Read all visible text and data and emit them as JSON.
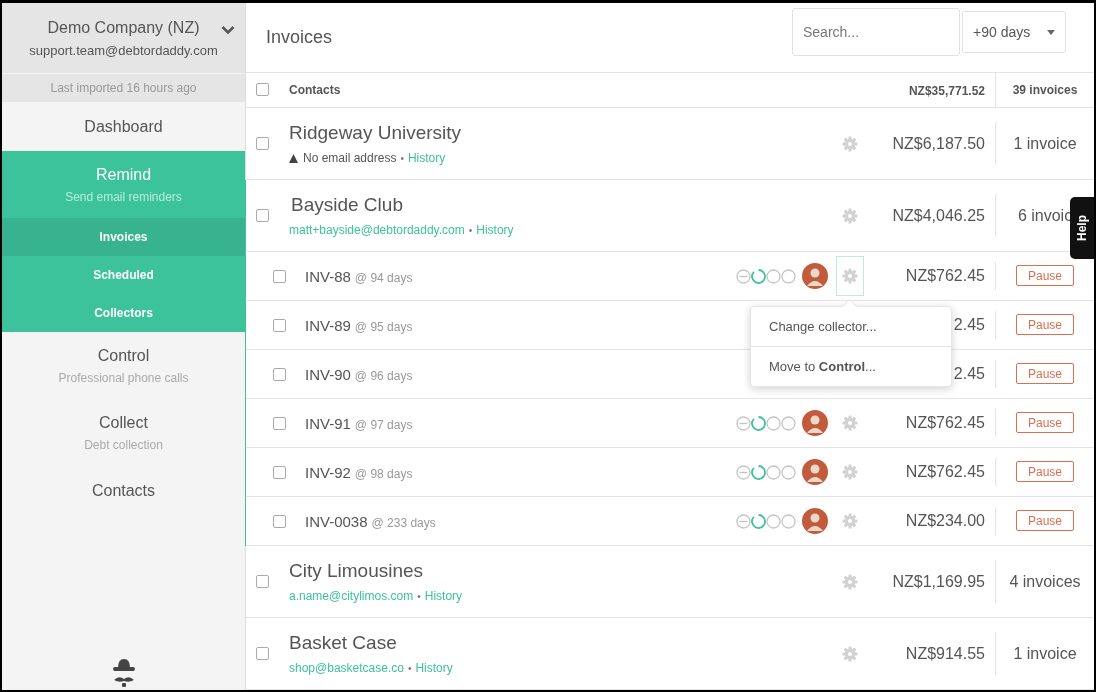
{
  "account": {
    "name": "Demo Company (NZ)",
    "email": "support.team@debtordaddy.com"
  },
  "last_imported": "Last imported 16 hours ago",
  "nav": [
    {
      "label": "Dashboard",
      "selected": false
    },
    {
      "label": "Remind",
      "subtitle": "Send email reminders",
      "selected": true,
      "children": [
        {
          "label": "Invoices",
          "selected": true
        },
        {
          "label": "Scheduled",
          "selected": false
        },
        {
          "label": "Collectors",
          "selected": false
        }
      ]
    },
    {
      "label": "Control",
      "subtitle": "Professional phone calls",
      "selected": false
    },
    {
      "label": "Collect",
      "subtitle": "Debt collection",
      "selected": false
    },
    {
      "label": "Contacts",
      "selected": false
    }
  ],
  "page_title": "Invoices",
  "search": {
    "placeholder": "Search..."
  },
  "filter": {
    "label": "+90 days"
  },
  "table_header": {
    "checked": false,
    "contacts": "Contacts",
    "total": "NZ$35,771.52",
    "count": "39 invoices"
  },
  "contacts": [
    {
      "name": "Ridgeway University",
      "checked": false,
      "info": {
        "kind": "warning",
        "text": "No email address"
      },
      "separator": "•",
      "history": "History",
      "amount": "NZ$6,187.50",
      "count": "1 invoice",
      "expanded": false
    },
    {
      "name": "Bayside Club",
      "checked": false,
      "info": {
        "kind": "email",
        "text": "matt+bayside@debtordaddy.com"
      },
      "separator": "•",
      "history": "History",
      "amount": "NZ$4,046.25",
      "count": "6 invoic",
      "expanded": true,
      "invoices": [
        {
          "number": "INV-88",
          "age": "@ 94 days",
          "checked": false,
          "steps": [
            {
              "kind": "skipped"
            },
            {
              "kind": "current"
            },
            {
              "kind": "pending"
            },
            {
              "kind": "pending"
            }
          ],
          "avatar": true,
          "gear": true,
          "menu_open": true,
          "amount": "NZ$762.45",
          "action": "Pause"
        },
        {
          "number": "INV-89",
          "age": "@ 95 days",
          "checked": false,
          "amount": "2.45",
          "action": "Pause"
        },
        {
          "number": "INV-90",
          "age": "@ 96 days",
          "checked": false,
          "amount": "2.45",
          "action": "Pause"
        },
        {
          "number": "INV-91",
          "age": "@ 97 days",
          "checked": false,
          "steps": [
            {
              "kind": "skipped"
            },
            {
              "kind": "current"
            },
            {
              "kind": "pending"
            },
            {
              "kind": "pending"
            }
          ],
          "avatar": true,
          "gear": true,
          "menu_open": false,
          "amount": "NZ$762.45",
          "action": "Pause"
        },
        {
          "number": "INV-92",
          "age": "@ 98 days",
          "checked": false,
          "steps": [
            {
              "kind": "skipped"
            },
            {
              "kind": "current"
            },
            {
              "kind": "pending"
            },
            {
              "kind": "pending"
            }
          ],
          "avatar": true,
          "gear": true,
          "menu_open": false,
          "amount": "NZ$762.45",
          "action": "Pause"
        },
        {
          "number": "INV-0038",
          "age": "@ 233 days",
          "checked": false,
          "steps": [
            {
              "kind": "skipped"
            },
            {
              "kind": "current"
            },
            {
              "kind": "pending"
            },
            {
              "kind": "pending"
            }
          ],
          "avatar": true,
          "gear": true,
          "menu_open": false,
          "amount": "NZ$234.00",
          "action": "Pause"
        }
      ]
    },
    {
      "name": "City Limousines",
      "checked": false,
      "info": {
        "kind": "email",
        "text": "a.name@citylimos.com"
      },
      "separator": "•",
      "history": "History",
      "amount": "NZ$1,169.95",
      "count": "4 invoices",
      "expanded": false
    },
    {
      "name": "Basket Case",
      "checked": false,
      "info": {
        "kind": "email",
        "text": "shop@basketcase.co"
      },
      "separator": "•",
      "history": "History",
      "amount": "NZ$914.55",
      "count": "1 invoice",
      "expanded": false
    }
  ],
  "menu": {
    "items": [
      "Change collector...",
      "Move to **Control**..."
    ]
  },
  "help": "Help"
}
